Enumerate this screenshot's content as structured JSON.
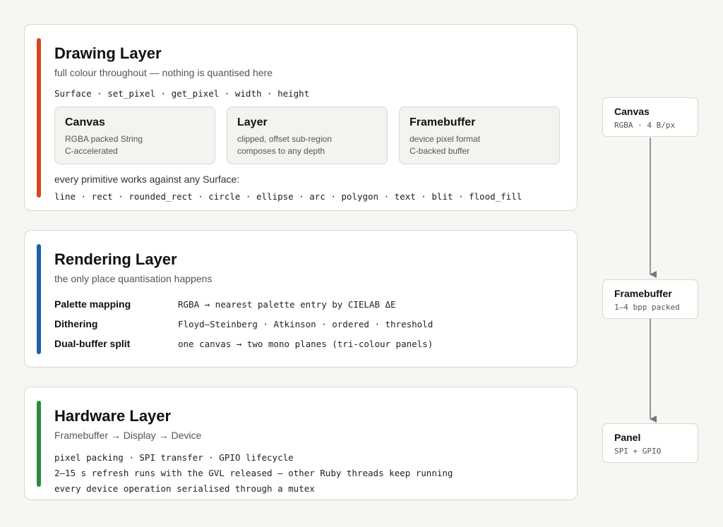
{
  "colors": {
    "drawing_accent": "#d9441b",
    "rendering_accent": "#1d5fae",
    "hardware_accent": "#2b8a3e",
    "arrow": "#777777"
  },
  "drawing": {
    "title": "Drawing Layer",
    "subtitle": "full colour throughout — nothing is quantised here",
    "api": "Surface · set_pixel · get_pixel · width · height",
    "boxes": [
      {
        "title": "Canvas",
        "line1": "RGBA packed String",
        "line2": "C-accelerated"
      },
      {
        "title": "Layer",
        "line1": "clipped, offset sub-region",
        "line2": "composes to any depth"
      },
      {
        "title": "Framebuffer",
        "line1": "device pixel format",
        "line2": "C-backed buffer"
      }
    ],
    "primitives_intro": "every primitive works against any Surface:",
    "primitives": "line · rect · rounded_rect · circle · ellipse · arc · polygon · text · blit · flood_fill"
  },
  "rendering": {
    "title": "Rendering Layer",
    "subtitle": "the only place quantisation happens",
    "rows": [
      {
        "label": "Palette mapping",
        "value": "RGBA → nearest palette entry by CIELAB ΔE"
      },
      {
        "label": "Dithering",
        "value": "Floyd–Steinberg · Atkinson · ordered · threshold"
      },
      {
        "label": "Dual-buffer split",
        "value": "one canvas → two mono planes (tri-colour panels)"
      }
    ]
  },
  "hardware": {
    "title": "Hardware Layer",
    "subtitle": "Framebuffer → Display → Device",
    "lines": [
      "pixel packing · SPI transfer · GPIO lifecycle",
      "2–15 s refresh runs with the GVL released — other Ruby threads keep running",
      "every device operation serialised through a mutex"
    ]
  },
  "flow": {
    "nodes": [
      {
        "title": "Canvas",
        "detail": "RGBA · 4 B/px"
      },
      {
        "title": "Framebuffer",
        "detail": "1–4 bpp packed"
      },
      {
        "title": "Panel",
        "detail": "SPI + GPIO"
      }
    ]
  }
}
